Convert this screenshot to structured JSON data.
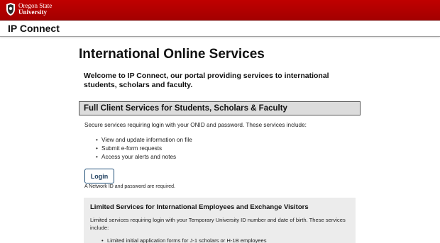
{
  "header": {
    "logo": {
      "line1": "Oregon State",
      "line2": "University",
      "icon": "osu-seal-icon"
    },
    "app_title": "IP Connect"
  },
  "main": {
    "title": "International Online Services",
    "welcome": "Welcome to IP Connect, our portal providing services to international students, scholars and faculty."
  },
  "full_services": {
    "heading": "Full Client Services for Students, Scholars & Faculty",
    "description": "Secure services requiring login with your ONID and password. These services include:",
    "items": [
      "View and update information on file",
      "Submit e-form requests",
      "Access your alerts and notes"
    ],
    "login_label": "Login",
    "login_note": "A Network ID and password are required."
  },
  "limited_services": {
    "heading": "Limited Services for International Employees and Exchange Visitors",
    "description": "Limited services requiring login with your Temporary University ID number and date of birth. These services include:",
    "items": [
      "Limited initial application forms for J-1 scholars or H-1B employees"
    ]
  },
  "colors": {
    "brand_red": "#b00000",
    "section_header_bg": "#dcdcdc",
    "limited_bg": "#ececec"
  }
}
